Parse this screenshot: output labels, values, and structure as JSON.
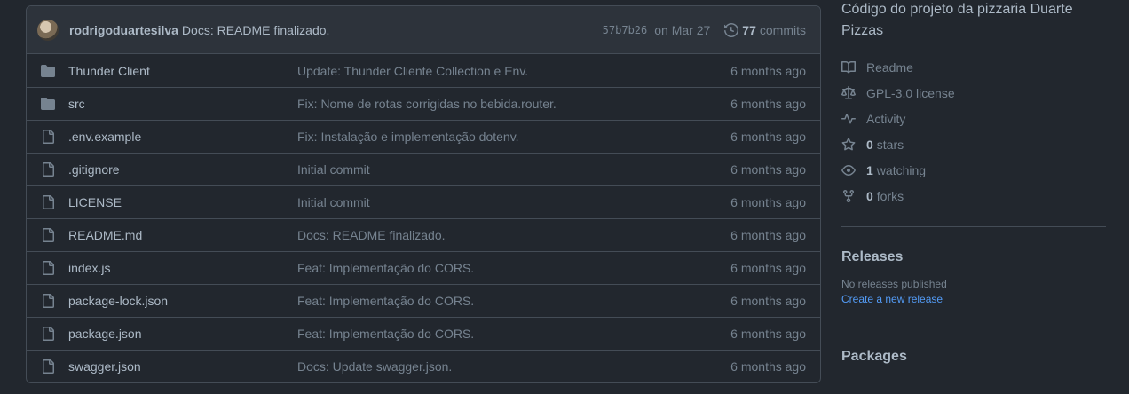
{
  "commit": {
    "author": "rodrigoduartesilva",
    "message": "Docs: README finalizado.",
    "sha": "57b7b26",
    "date": "on Mar 27",
    "commits_count": "77",
    "commits_label": "commits"
  },
  "files": [
    {
      "name": "Thunder Client",
      "type": "folder",
      "message": "Update: Thunder Cliente Collection e Env.",
      "time": "6 months ago"
    },
    {
      "name": "src",
      "type": "folder",
      "message": "Fix: Nome de rotas corrigidas no bebida.router.",
      "time": "6 months ago"
    },
    {
      "name": ".env.example",
      "type": "file",
      "message": "Fix: Instalação e implementação dotenv.",
      "time": "6 months ago"
    },
    {
      "name": ".gitignore",
      "type": "file",
      "message": "Initial commit",
      "time": "6 months ago"
    },
    {
      "name": "LICENSE",
      "type": "file",
      "message": "Initial commit",
      "time": "6 months ago"
    },
    {
      "name": "README.md",
      "type": "file",
      "message": "Docs: README finalizado.",
      "time": "6 months ago"
    },
    {
      "name": "index.js",
      "type": "file",
      "message": "Feat: Implementação do CORS.",
      "time": "6 months ago"
    },
    {
      "name": "package-lock.json",
      "type": "file",
      "message": "Feat: Implementação do CORS.",
      "time": "6 months ago"
    },
    {
      "name": "package.json",
      "type": "file",
      "message": "Feat: Implementação do CORS.",
      "time": "6 months ago"
    },
    {
      "name": "swagger.json",
      "type": "file",
      "message": "Docs: Update swagger.json.",
      "time": "6 months ago"
    }
  ],
  "sidebar": {
    "about": "Código do projeto da pizzaria Duarte Pizzas",
    "readme": "Readme",
    "license": "GPL-3.0 license",
    "activity": "Activity",
    "stars_count": "0",
    "stars_label": "stars",
    "watching_count": "1",
    "watching_label": "watching",
    "forks_count": "0",
    "forks_label": "forks",
    "releases_title": "Releases",
    "releases_empty": "No releases published",
    "releases_link": "Create a new release",
    "packages_title": "Packages"
  },
  "colors": {
    "background": "#22272e",
    "border": "#444c56",
    "link": "#539bf5",
    "muted": "#768390"
  }
}
